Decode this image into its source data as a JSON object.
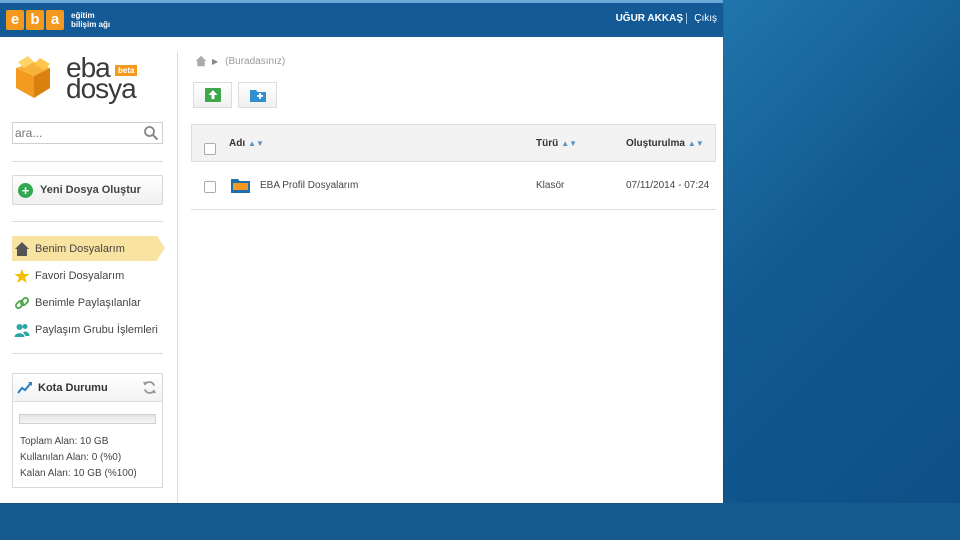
{
  "header": {
    "brand_letters": [
      "e",
      "b",
      "a"
    ],
    "brand_sub_line1": "eğitim",
    "brand_sub_line2": "bilişim ağı",
    "user_name": "UĞUR AKKAŞ",
    "logout_label": "Çıkış"
  },
  "logo": {
    "eba": "eba",
    "beta": "beta",
    "dosya": "dosya"
  },
  "search": {
    "placeholder": "ara..."
  },
  "new_file_label": "Yeni Dosya Oluştur",
  "nav": {
    "items": [
      {
        "label": "Benim Dosyalarım",
        "icon": "home-icon",
        "active": true
      },
      {
        "label": "Favori Dosyalarım",
        "icon": "star-icon",
        "active": false
      },
      {
        "label": "Benimle Paylaşılanlar",
        "icon": "link-icon",
        "active": false
      },
      {
        "label": "Paylaşım Grubu İşlemleri",
        "icon": "users-icon",
        "active": false
      }
    ]
  },
  "quota": {
    "title": "Kota Durumu",
    "used_fraction": 0,
    "total": "Toplam Alan: 10 GB",
    "used": "Kullanılan Alan: 0 (%0)",
    "remaining": "Kalan Alan: 10 GB (%100)"
  },
  "breadcrumb": {
    "current": "(Buradasınız)"
  },
  "table": {
    "columns": {
      "name": "Adı",
      "type": "Türü",
      "created": "Oluşturulma"
    },
    "rows": [
      {
        "name": "EBA Profil Dosyalarım",
        "type": "Klasör",
        "created": "07/11/2014 - 07:24",
        "folder_badge": "eba"
      }
    ]
  },
  "colors": {
    "header_blue": "#135a96",
    "accent_orange": "#f39a1e",
    "active_nav": "#f8e4a0",
    "add_green": "#2fa84f"
  }
}
